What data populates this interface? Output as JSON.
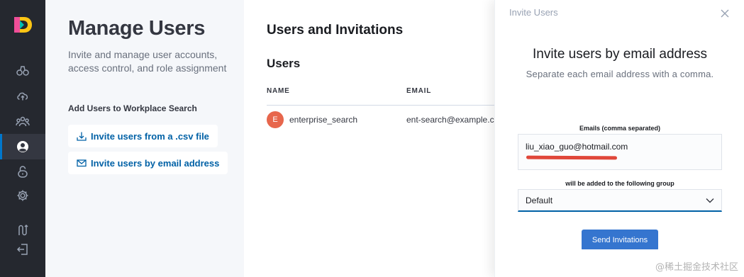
{
  "subnav": {
    "title": "Manage Users",
    "description": "Invite and manage user accounts, access control, and role assignment",
    "section_title": "Add Users to Workplace Search",
    "actions": [
      {
        "label": "Invite users from a .csv file",
        "icon": "upload-icon"
      },
      {
        "label": "Invite users by email address",
        "icon": "envelope-icon"
      }
    ]
  },
  "main": {
    "page_title": "Users and Invitations",
    "users_heading": "Users",
    "columns": [
      "NAME",
      "EMAIL"
    ],
    "rows": [
      {
        "avatar": "E",
        "name": "enterprise_search",
        "email": "ent-search@example.com"
      }
    ]
  },
  "flyout": {
    "title": "Invite Users",
    "heading": "Invite users by email address",
    "subheading": "Separate each email address with a comma.",
    "emails_label": "Emails (comma separated)",
    "emails_value": "liu_xiao_guo@hotmail.com",
    "group_label": "will be added to the following group",
    "group_value": "Default",
    "send_label": "Send Invitations"
  },
  "rail_icons": [
    "binoculars-icon",
    "cloud-upload-icon",
    "users-group-icon",
    "user-circle-icon",
    "lock-icon",
    "gear-icon",
    "route-icon",
    "logout-icon"
  ],
  "watermark": "@稀土掘金技术社区",
  "colors": {
    "accent": "#0061a6",
    "button": "#3575cf",
    "rail": "#25282f",
    "avatar": "#e7664c"
  }
}
